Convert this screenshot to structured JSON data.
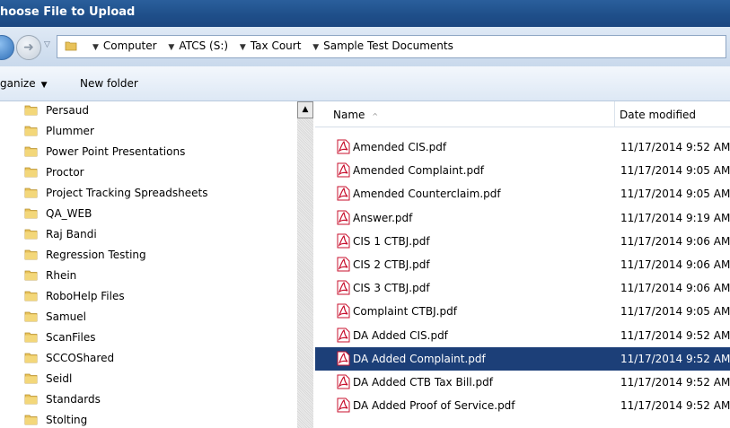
{
  "window": {
    "title": "hoose File to Upload"
  },
  "address": {
    "crumbs": [
      "Computer",
      "ATCS (S:)",
      "Tax Court",
      "Sample Test Documents"
    ]
  },
  "toolbar": {
    "organize_label": "ganize",
    "new_folder_label": "New folder"
  },
  "tree": {
    "items": [
      "Persaud",
      "Plummer",
      "Power Point Presentations",
      "Proctor",
      "Project Tracking Spreadsheets",
      "QA_WEB",
      "Raj Bandi",
      "Regression Testing",
      "Rhein",
      "RoboHelp Files",
      "Samuel",
      "ScanFiles",
      "SCCOShared",
      "Seidl",
      "Standards",
      "Stolting"
    ]
  },
  "columns": {
    "name": "Name",
    "date_modified": "Date modified"
  },
  "files": [
    {
      "name": "Amended CIS.pdf",
      "date": "11/17/2014 9:52 AM",
      "selected": false
    },
    {
      "name": "Amended Complaint.pdf",
      "date": "11/17/2014 9:05 AM",
      "selected": false
    },
    {
      "name": "Amended Counterclaim.pdf",
      "date": "11/17/2014 9:05 AM",
      "selected": false
    },
    {
      "name": "Answer.pdf",
      "date": "11/17/2014 9:19 AM",
      "selected": false
    },
    {
      "name": "CIS 1 CTBJ.pdf",
      "date": "11/17/2014 9:06 AM",
      "selected": false
    },
    {
      "name": "CIS 2 CTBJ.pdf",
      "date": "11/17/2014 9:06 AM",
      "selected": false
    },
    {
      "name": "CIS 3 CTBJ.pdf",
      "date": "11/17/2014 9:06 AM",
      "selected": false
    },
    {
      "name": "Complaint CTBJ.pdf",
      "date": "11/17/2014 9:05 AM",
      "selected": false
    },
    {
      "name": "DA Added CIS.pdf",
      "date": "11/17/2014 9:52 AM",
      "selected": false
    },
    {
      "name": "DA Added Complaint.pdf",
      "date": "11/17/2014 9:52 AM",
      "selected": true
    },
    {
      "name": "DA Added CTB Tax Bill.pdf",
      "date": "11/17/2014 9:52 AM",
      "selected": false
    },
    {
      "name": "DA Added Proof of Service.pdf",
      "date": "11/17/2014 9:52 AM",
      "selected": false
    }
  ],
  "icons": {
    "folder": "folder-icon",
    "pdf": "pdf-file-icon",
    "back": "back-arrow-icon",
    "forward": "forward-arrow-icon"
  },
  "colors": {
    "titlebar": "#1f4f8a",
    "selection": "#1c3f78",
    "pdf_red": "#c8102e",
    "folder_yellow": "#e8c25a"
  }
}
